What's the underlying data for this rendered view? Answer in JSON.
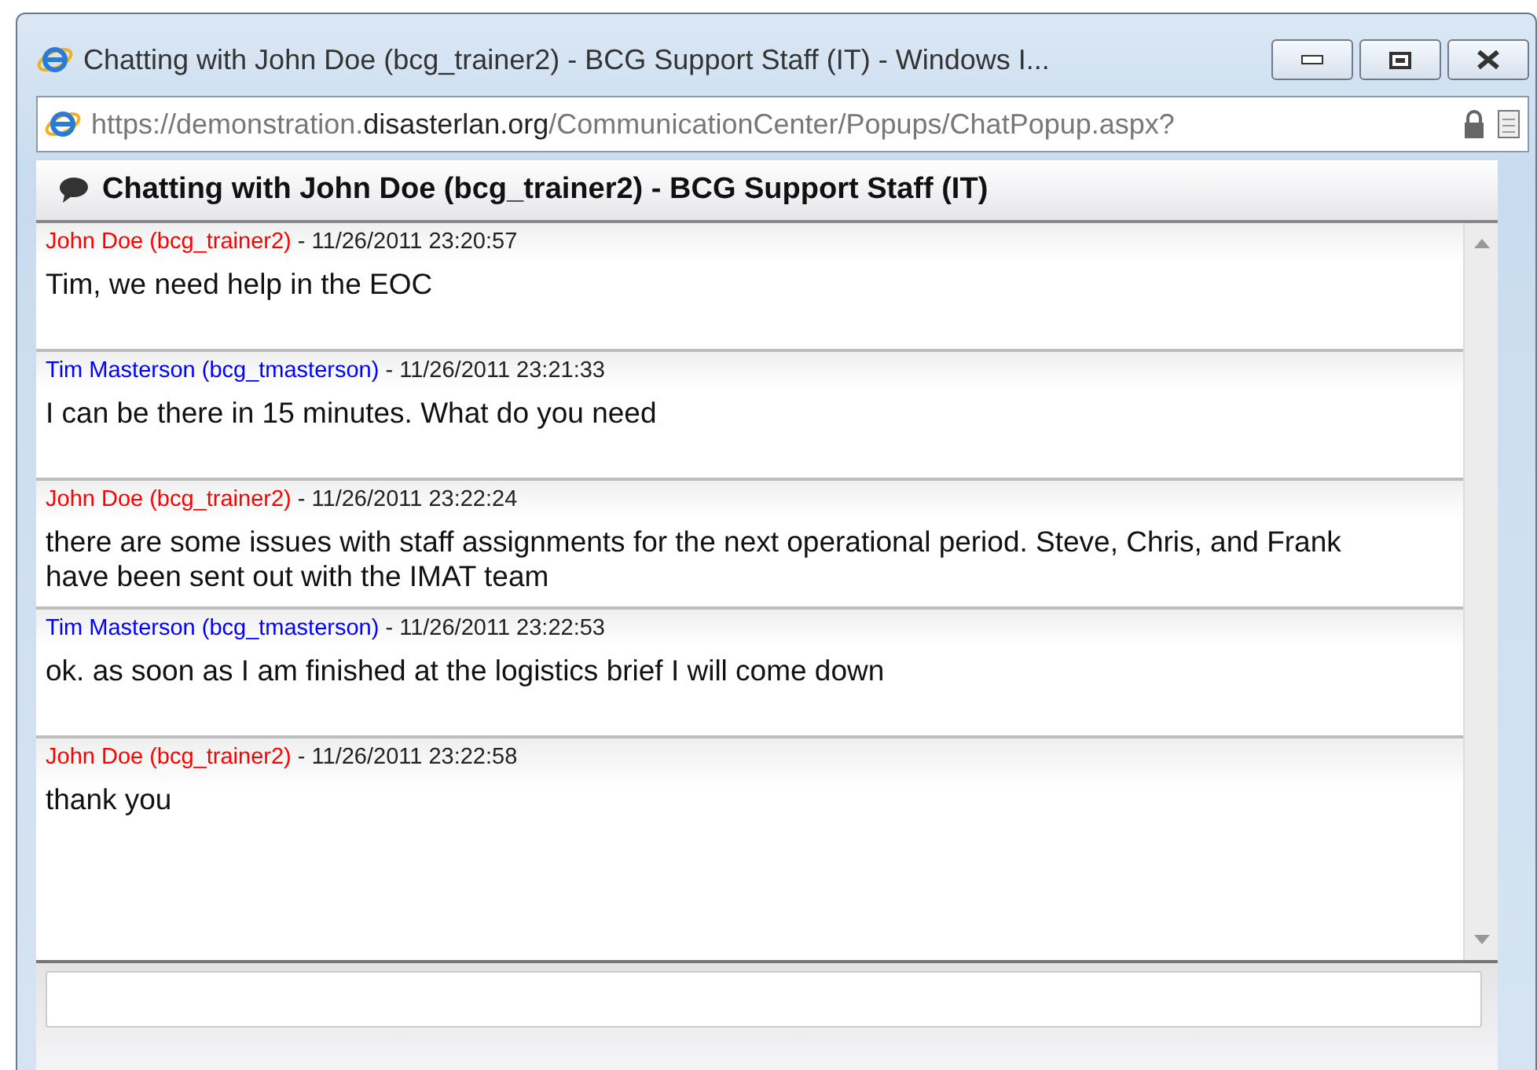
{
  "window": {
    "title": "Chatting with John Doe (bcg_trainer2) - BCG Support Staff (IT) - Windows I...",
    "address": "https://demonstration.**disasterlan.org**/CommunicationCenter/Popups/ChatPopup.aspx?"
  },
  "chat": {
    "title": "Chatting with John Doe (bcg_trainer2) - BCG Support Staff (IT)",
    "messages": [
      {
        "sender": "John Doe (bcg_trainer2)",
        "color": "#ff0000",
        "time": " - 11/26/2011 23:20:57",
        "text": "Tim, we need help in the EOC"
      },
      {
        "sender": "Tim Masterson (bcg_tmasterson)",
        "color": "#0000ff",
        "time": " - 11/26/2011 23:21:33",
        "text": "I can be there in 15 minutes. What do you need"
      },
      {
        "sender": "John Doe (bcg_trainer2)",
        "color": "#ff0000",
        "time": " - 11/26/2011 23:22:24",
        "text": "there are some issues with staff assignments for the next operational period. Steve, Chris, and Frank have been sent out with the IMAT team"
      },
      {
        "sender": "Tim Masterson (bcg_tmasterson)",
        "color": "#0000ff",
        "time": " - 11/26/2011 23:22:53",
        "text": "ok. as soon as I am finished at the logistics brief I will come down"
      },
      {
        "sender": "John Doe (bcg_trainer2)",
        "color": "#ff0000",
        "time": " - 11/26/2011 23:22:58",
        "text": "thank you"
      }
    ]
  }
}
